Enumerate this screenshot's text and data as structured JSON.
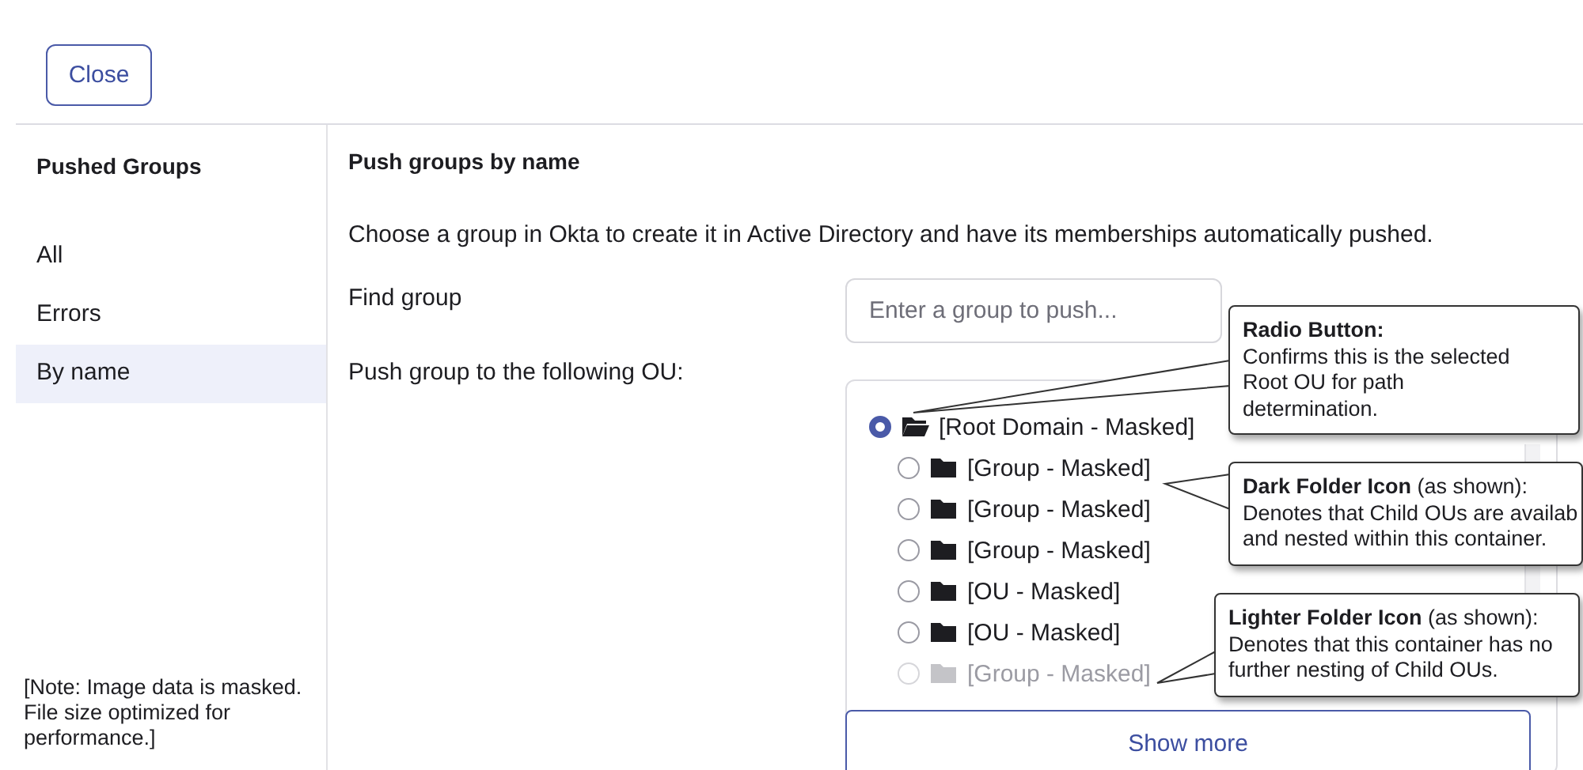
{
  "close_button": "Close",
  "sidebar": {
    "title": "Pushed Groups",
    "items": [
      {
        "label": "All",
        "selected": false
      },
      {
        "label": "Errors",
        "selected": false
      },
      {
        "label": "By name",
        "selected": true
      }
    ],
    "note": "[Note: Image data is masked. File size optimized for performance.]"
  },
  "main": {
    "title": "Push groups by name",
    "description": "Choose a group in Okta to create it in Active Directory and have its memberships automatically pushed.",
    "find_label": "Find group",
    "find_placeholder": "Enter a group to push...",
    "ou_label": "Push group to the following OU:",
    "tree": [
      {
        "label": "[Root Domain - Masked]",
        "selected": true,
        "expanded": true,
        "disabled": false,
        "children": [
          {
            "label": "[Group - Masked]",
            "selected": false,
            "expanded": false,
            "disabled": false
          },
          {
            "label": "[Group - Masked]",
            "selected": false,
            "expanded": false,
            "disabled": false
          },
          {
            "label": "[Group - Masked]",
            "selected": false,
            "expanded": false,
            "disabled": false
          },
          {
            "label": "[OU - Masked]",
            "selected": false,
            "expanded": false,
            "disabled": false
          },
          {
            "label": "[OU - Masked]",
            "selected": false,
            "expanded": false,
            "disabled": false
          },
          {
            "label": "[Group - Masked]",
            "selected": false,
            "expanded": false,
            "disabled": true
          }
        ]
      }
    ],
    "show_more": "Show more"
  },
  "callouts": [
    {
      "lines": [
        "**Radio Button:**",
        "Confirms this is the selected",
        "Root OU for path",
        "determination."
      ]
    },
    {
      "lines": [
        "**Dark Folder Icon** (as shown):",
        "Denotes that Child OUs are availab",
        "and nested within this container."
      ]
    },
    {
      "lines": [
        "**Lighter Folder Icon** (as shown):",
        "Denotes that this container has no",
        "further nesting of Child OUs."
      ]
    }
  ]
}
